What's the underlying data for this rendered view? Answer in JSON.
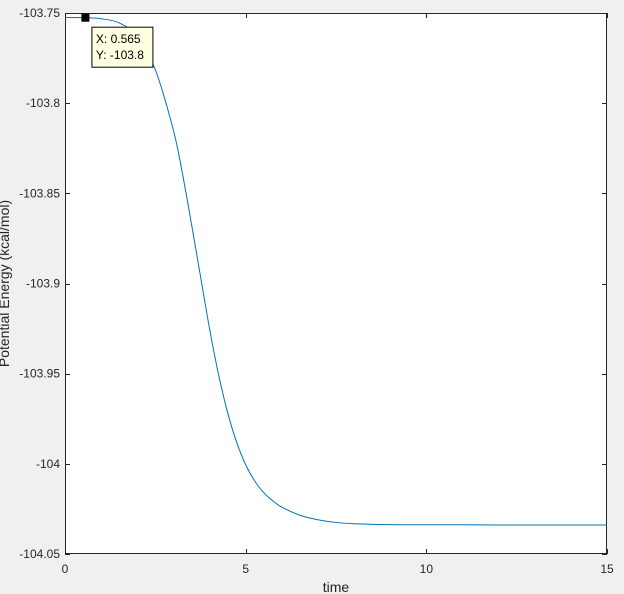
{
  "chart_data": {
    "type": "line",
    "title": "",
    "xlabel": "time",
    "ylabel": "Potential Energy (kcal/mol)",
    "xlim": [
      0,
      15
    ],
    "ylim": [
      -104.05,
      -103.75
    ],
    "xticks": [
      0,
      5,
      10,
      15
    ],
    "yticks": [
      -103.75,
      -103.8,
      -103.85,
      -103.9,
      -103.95,
      -104,
      -104.05
    ],
    "xtick_labels": [
      "0",
      "5",
      "10",
      "15"
    ],
    "ytick_labels": [
      "-103.75",
      "-103.8",
      "-103.85",
      "-103.9",
      "-103.95",
      "-104",
      "-104.05"
    ],
    "grid": false,
    "series": [
      {
        "color": "#0072bd",
        "x": [
          0,
          0.5,
          1,
          1.5,
          2,
          2.5,
          3,
          3.25,
          3.5,
          3.75,
          4,
          4.25,
          4.5,
          4.75,
          5,
          5.25,
          5.5,
          5.75,
          6,
          6.5,
          7,
          7.5,
          8,
          9,
          10,
          11,
          12,
          13,
          14,
          15
        ],
        "y": [
          -103.7525,
          -103.7526,
          -103.7532,
          -103.7555,
          -103.763,
          -103.7815,
          -103.815,
          -103.839,
          -103.867,
          -103.896,
          -103.925,
          -103.9505,
          -103.9715,
          -103.988,
          -104.0005,
          -104.0095,
          -104.016,
          -104.0205,
          -104.024,
          -104.0285,
          -104.031,
          -104.0325,
          -104.0332,
          -104.0337,
          -104.0338,
          -104.0338,
          -104.0339,
          -104.0339,
          -104.0339,
          -104.0339
        ]
      }
    ],
    "datatip": {
      "x": 0.565,
      "y": -103.7526,
      "x_text": "X: 0.565",
      "y_text": "Y: -103.8"
    }
  },
  "colors": {
    "figure_background": "#f0f0f0",
    "axes_background": "#ffffff",
    "axis_color": "#262626",
    "line_color": "#0072bd",
    "datatip_background": "#ffffe1"
  }
}
